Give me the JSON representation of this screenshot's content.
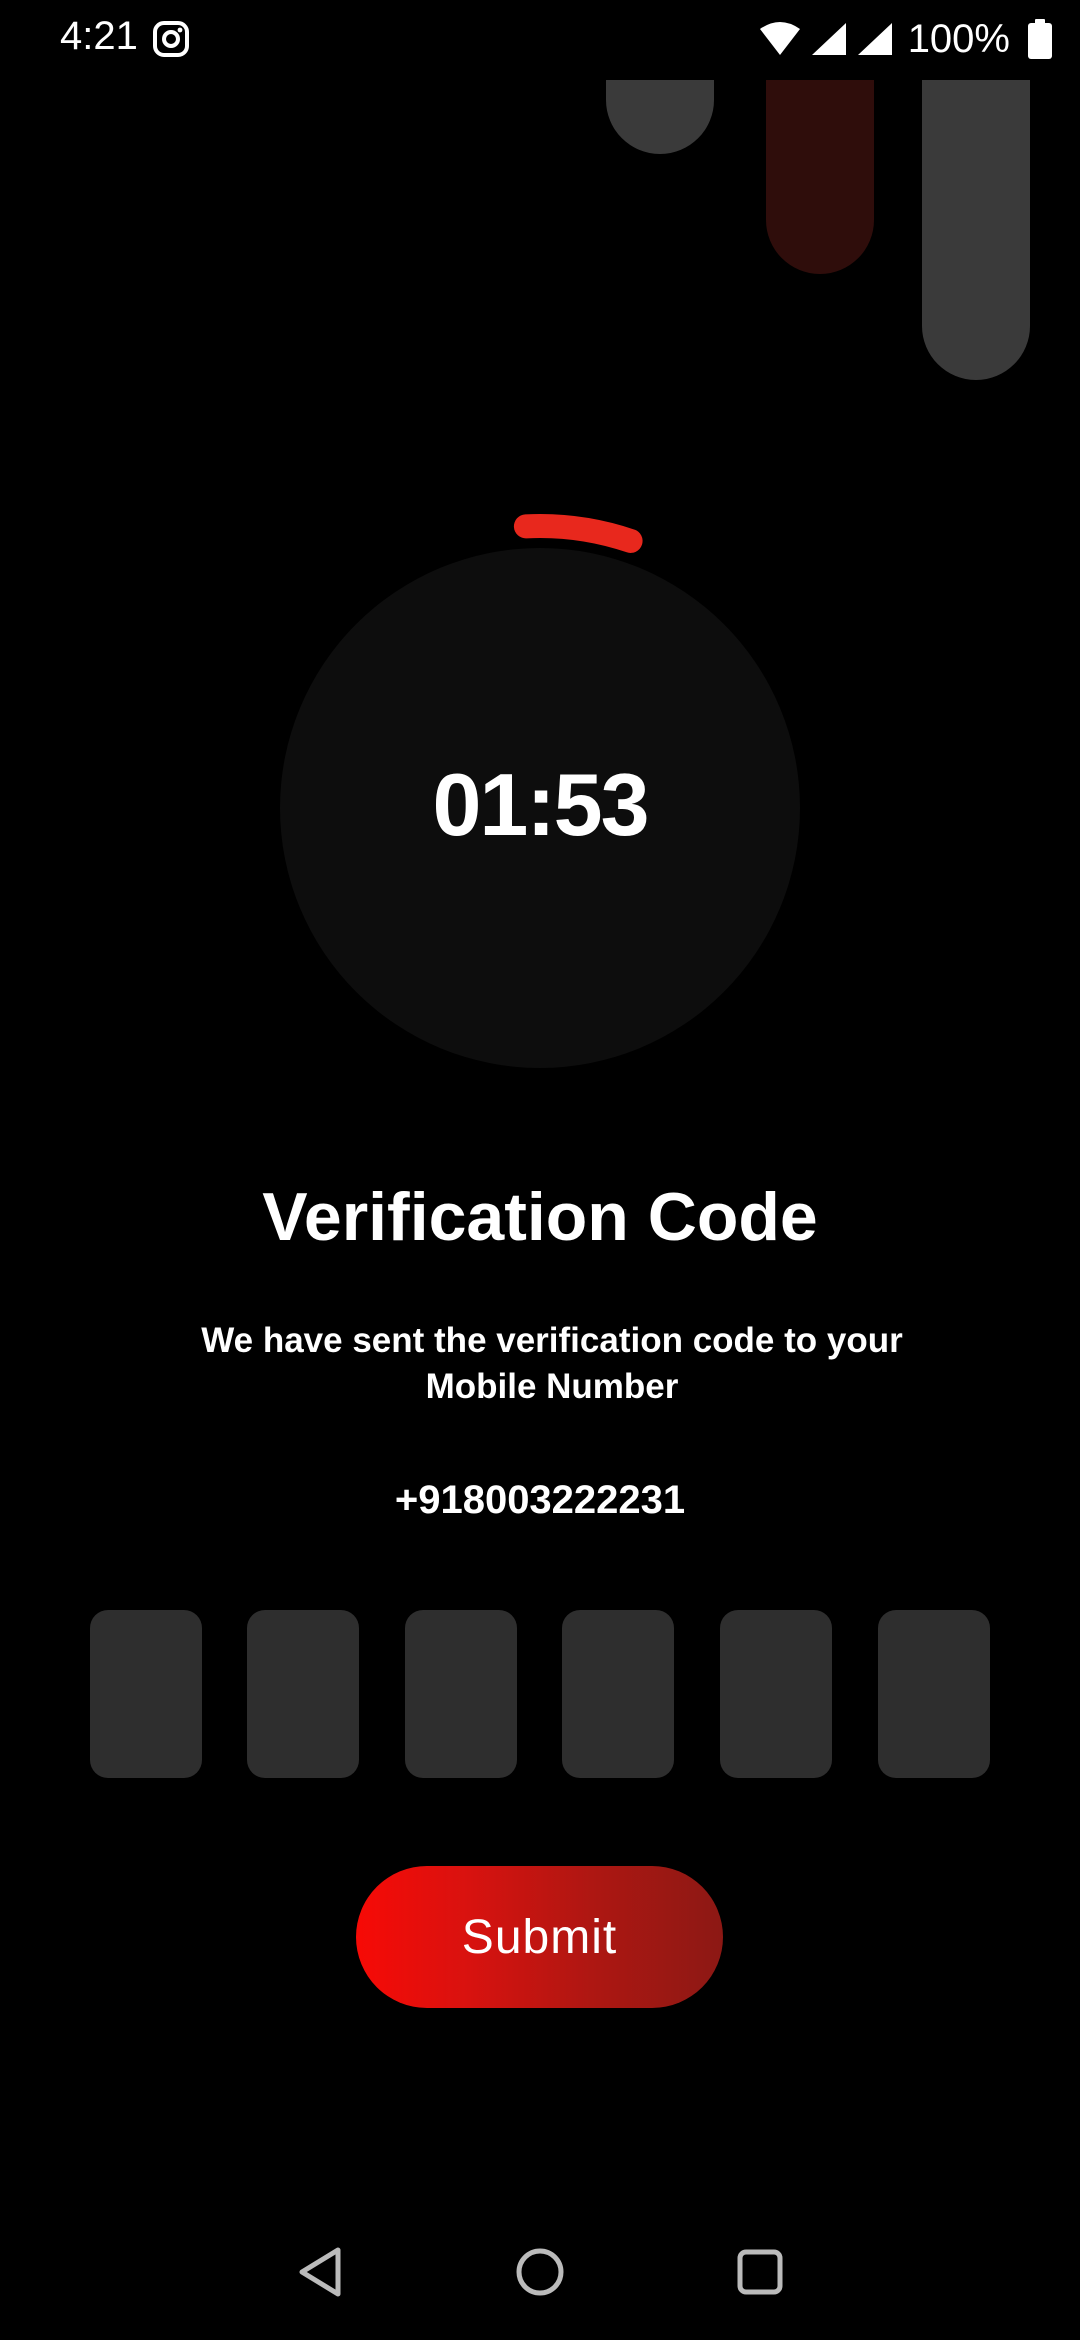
{
  "status_bar": {
    "time": "4:21",
    "battery": "100%",
    "icons": [
      "instagram-icon",
      "wifi-icon",
      "cell-signal-icon",
      "cell-signal-icon",
      "battery-icon"
    ]
  },
  "timer": {
    "value": "01:53",
    "progress_fraction": 0.06,
    "ring_color": "#e8281d",
    "face_color": "#0d0d0d"
  },
  "title": "Verification Code",
  "description": "We have sent the verification code to your Mobile Number",
  "phone_number": "+918003222231",
  "otp": {
    "digits": [
      "",
      "",
      "",
      "",
      "",
      ""
    ]
  },
  "submit": {
    "label": "Submit"
  },
  "nav_bar": {
    "icons": [
      "back-icon",
      "home-icon",
      "recents-icon"
    ]
  },
  "colors": {
    "background": "#000000",
    "accent": "#f70a06",
    "box": "#2e2e2e",
    "pill_gray": "#3a3a3a",
    "pill_red": "#2f0d0b"
  }
}
